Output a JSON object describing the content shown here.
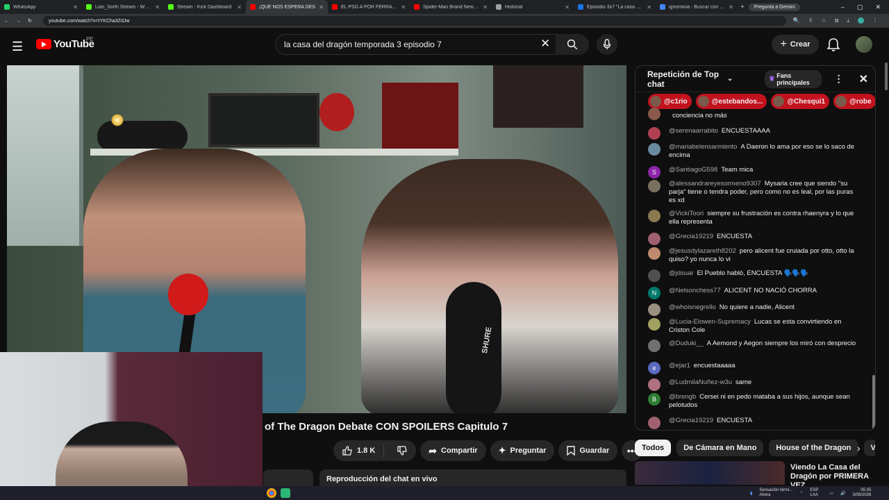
{
  "browser": {
    "tabs": [
      {
        "title": "WhatsApp",
        "color": "#25d366",
        "active": false
      },
      {
        "title": "Lian_Sorth Stream - Watch Live",
        "color": "#53fc18",
        "active": false
      },
      {
        "title": "Stream - Kick Dashboard",
        "color": "#53fc18",
        "active": false
      },
      {
        "title": "¡QUE NOS ESPERA DES",
        "color": "#ff0000",
        "active": true
      },
      {
        "title": "EL PSG A POR FERRAN TOR",
        "color": "#ff0000",
        "active": false
      },
      {
        "title": "Spider-Man Brand New Da",
        "color": "#ff0000",
        "active": false
      },
      {
        "title": "Historial",
        "color": "#9aa0a6",
        "active": false
      },
      {
        "title": "Episodio 3x7 \"La casa del d",
        "color": "#1a73e8",
        "active": false
      },
      {
        "title": "ignominia - Buscar con Google",
        "color": "#4285f4",
        "active": false
      }
    ],
    "new_tab": "+",
    "gemini_label": "Pregunta a Gemini",
    "url": "youtube.com/watch?v=IYKCha3ZdJw",
    "window_controls": [
      "–",
      "▢",
      "✕"
    ]
  },
  "youtube": {
    "logo_text": "YouTube",
    "country_code": "PE",
    "search_value": "la casa del dragón temporada 3 episodio 7",
    "create_label": "Crear",
    "video_title": "of The Dragon Debate CON SPOILERS Capitulo 7",
    "like_count": "1.8 K",
    "share_label": "Compartir",
    "ask_label": "Preguntar",
    "save_label": "Guardar",
    "chat_replay_label": "Reproducción del chat en vivo",
    "shure_text": "SHURE"
  },
  "chat": {
    "header_title": "Repetición de Top chat",
    "fans_label": "Fans principales",
    "donors": [
      "@c1rio",
      "@estebandos...",
      "@Chesqui1",
      "@robe"
    ],
    "messages": [
      {
        "author": "",
        "text": "conciencia no más",
        "avatar": "",
        "color": "#8a5a4a"
      },
      {
        "author": "@serenaarrabito",
        "text": "ENCUESTAAAA",
        "avatar": "",
        "color": "#b04050"
      },
      {
        "author": "@mariabelensarmiento",
        "text": "A Daeron lo ama por eso se lo saco de encima",
        "avatar": "",
        "color": "#6a8aa0"
      },
      {
        "author": "@SantiagoG598",
        "text": "Team mica",
        "avatar": "S",
        "color": "#8e24aa"
      },
      {
        "author": "@alessandrareyesormeno9307",
        "text": "Mysaria cree que siendo \"su parja\" tiene o tendra poder, pero como no es leal, por las puras es xd",
        "avatar": "",
        "color": "#7a7060"
      },
      {
        "author": "@VickiToori",
        "text": "siempre su frustración es contra rhaenyra y lo que ella representa",
        "avatar": "",
        "color": "#8a7a50"
      },
      {
        "author": "@Grecia19219",
        "text": "ENCUESTA",
        "avatar": "",
        "color": "#a06070"
      },
      {
        "author": "@jesusdylazareth8202",
        "text": "pero alicent fue cruiada por otto, otto la quiso? yo nunca lo vi",
        "avatar": "",
        "color": "#c08a70"
      },
      {
        "author": "@jdsuar",
        "text": "El Pueblo habló, ENCUESTA 🗣️🗣️🗣️",
        "avatar": "",
        "color": "#505050"
      },
      {
        "author": "@Nelsonchess77",
        "text": "ALICENT NO NACIÓ CHORRA",
        "avatar": "N",
        "color": "#00796b"
      },
      {
        "author": "@whoisnegrello",
        "text": "No quiere a nadie, Alicent",
        "avatar": "",
        "color": "#9a9080"
      },
      {
        "author": "@Lucia-Elowen-Supremacy",
        "text": "Lucas se esta convirtiendo en Criston Cole",
        "avatar": "",
        "color": "#a0a060"
      },
      {
        "author": "@Duduki__",
        "text": "A Aemond y Aegon siempre los miró con desprecio",
        "avatar": "",
        "color": "#707070"
      },
      {
        "author": "@ejar1",
        "text": "encuestaaaaa",
        "avatar": "e",
        "color": "#5c6bc0"
      },
      {
        "author": "@LudmilaNuñez-w3u",
        "text": "same",
        "avatar": "",
        "color": "#b07080"
      },
      {
        "author": "@brengb",
        "text": "Cersei ni en pedo mataba a sus hijos, aunque sean pelotudos",
        "avatar": "B",
        "color": "#2e7d32"
      },
      {
        "author": "@Grecia19219",
        "text": "ENCUESTA",
        "avatar": "",
        "color": "#a06070"
      }
    ]
  },
  "chips": [
    "Todos",
    "De Cámara en Mano",
    "House of the Dragon",
    "V"
  ],
  "recommendation": {
    "title": "Viendo La Casa del Dragón por PRIMERA VEZ"
  },
  "taskbar": {
    "weather": "Sensación térmi...",
    "weather_sub": "Ahora",
    "lang": "ESP LAA",
    "time": "05:35",
    "date": "3/08/2026"
  }
}
